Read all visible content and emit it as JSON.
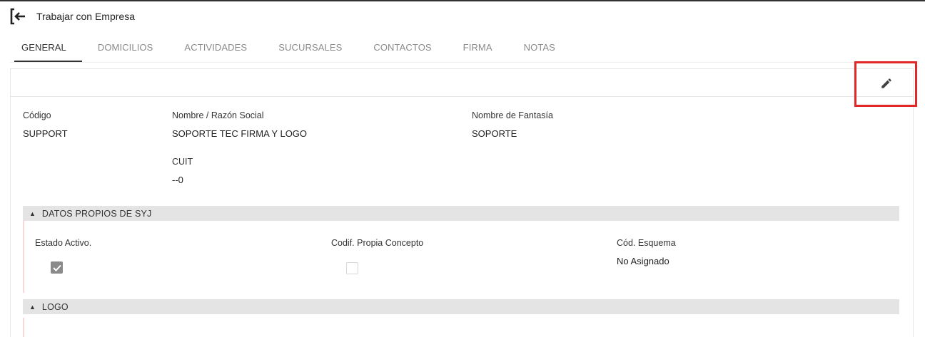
{
  "header": {
    "title": "Trabajar con Empresa",
    "back_icon": "exit-back-icon"
  },
  "tabs": [
    {
      "label": "GENERAL",
      "active": true
    },
    {
      "label": "DOMICILIOS",
      "active": false
    },
    {
      "label": "ACTIVIDADES",
      "active": false
    },
    {
      "label": "SUCURSALES",
      "active": false
    },
    {
      "label": "CONTACTOS",
      "active": false
    },
    {
      "label": "FIRMA",
      "active": false
    },
    {
      "label": "NOTAS",
      "active": false
    }
  ],
  "toolbar": {
    "edit_icon": "pencil-icon",
    "highlight_color": "#e32626"
  },
  "general": {
    "codigo": {
      "label": "Código",
      "value": "SUPPORT"
    },
    "nombre": {
      "label": "Nombre / Razón Social",
      "value": "SOPORTE TEC FIRMA Y LOGO"
    },
    "fantasia": {
      "label": "Nombre de Fantasía",
      "value": "SOPORTE"
    },
    "cuit": {
      "label": "CUIT",
      "value": "--0"
    }
  },
  "sections": {
    "datos_propios": {
      "title": "DATOS PROPIOS DE SYJ",
      "estado_activo": {
        "label": "Estado Activo.",
        "checked": true
      },
      "codif_propia": {
        "label": "Codif. Propia Concepto",
        "checked": false
      },
      "cod_esquema": {
        "label": "Cód. Esquema",
        "value": "No Asignado"
      }
    },
    "logo": {
      "title": "LOGO"
    }
  }
}
